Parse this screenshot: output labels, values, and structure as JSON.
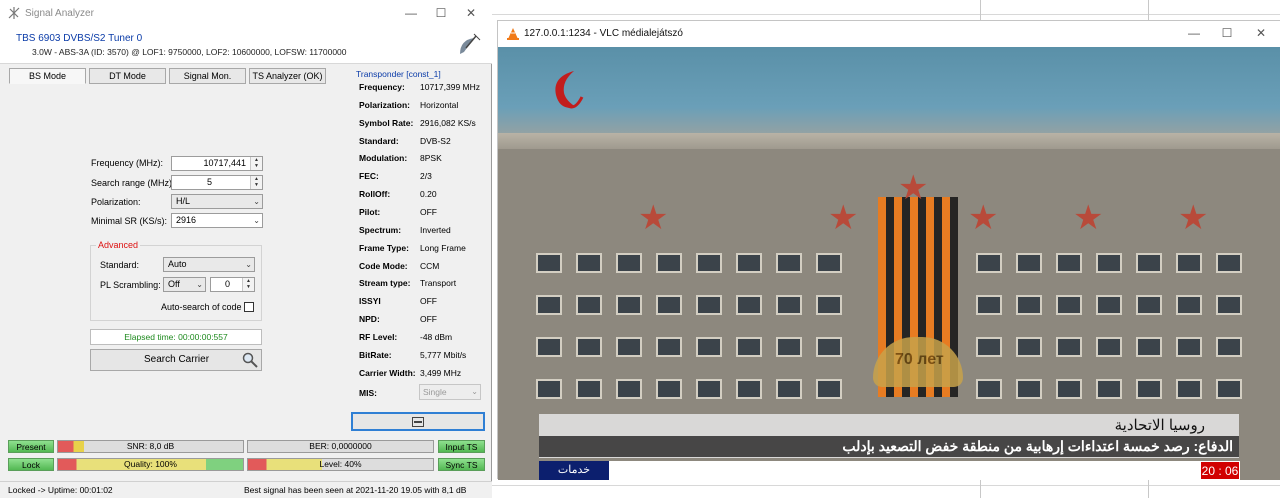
{
  "signal_analyzer": {
    "window_title": "Signal Analyzer",
    "device_name": "TBS 6903 DVBS/S2 Tuner 0",
    "device_info": "3.0W - ABS-3A (ID: 3570) @ LOF1: 9750000, LOF2: 10600000, LOFSW: 11700000",
    "tabs": [
      "BS Mode",
      "DT Mode",
      "Signal Mon.",
      "TS Analyzer (OK)"
    ],
    "active_tab": "BS Mode",
    "form": {
      "frequency_label": "Frequency (MHz):",
      "frequency_value": "10717,441",
      "search_range_label": "Search range (MHz):",
      "search_range_value": "5",
      "polarization_label": "Polarization:",
      "polarization_value": "H/L",
      "minimal_sr_label": "Minimal SR (KS/s):",
      "minimal_sr_value": "2916"
    },
    "advanced": {
      "title": "Advanced",
      "standard_label": "Standard:",
      "standard_value": "Auto",
      "pl_scrambling_label": "PL Scrambling:",
      "pl_scrambling_value": "Off",
      "pl_scrambling_code": "0",
      "auto_search_label": "Auto-search of code"
    },
    "elapsed": "Elapsed time: 00:00:00:557",
    "search_button": "Search Carrier",
    "transponder": {
      "title": "Transponder [const_1]",
      "rows": [
        {
          "label": "Frequency:",
          "value": "10717,399 MHz"
        },
        {
          "label": "Polarization:",
          "value": "Horizontal"
        },
        {
          "label": "Symbol Rate:",
          "value": "2916,082 KS/s"
        },
        {
          "label": "Standard:",
          "value": "DVB-S2"
        },
        {
          "label": "Modulation:",
          "value": "8PSK"
        },
        {
          "label": "FEC:",
          "value": "2/3"
        },
        {
          "label": "RollOff:",
          "value": "0.20"
        },
        {
          "label": "Pilot:",
          "value": "OFF"
        },
        {
          "label": "Spectrum:",
          "value": "Inverted"
        },
        {
          "label": "Frame Type:",
          "value": "Long Frame"
        },
        {
          "label": "Code Mode:",
          "value": "CCM"
        },
        {
          "label": "Stream type:",
          "value": "Transport"
        },
        {
          "label": "ISSYI",
          "value": "OFF"
        },
        {
          "label": "NPD:",
          "value": "OFF"
        },
        {
          "label": "RF Level:",
          "value": "-48 dBm"
        },
        {
          "label": "BitRate:",
          "value": "5,777 Mbit/s"
        },
        {
          "label": "Carrier Width:",
          "value": "3,499 MHz"
        }
      ],
      "mis_label": "MIS:",
      "mis_value": "Single"
    },
    "indicators": {
      "present": "Present",
      "lock": "Lock",
      "input_ts": "Input TS",
      "sync_ts": "Sync TS",
      "snr": "SNR: 8,0 dB",
      "snr_level": 0.14,
      "ber": "BER: 0,0000000",
      "quality": "Quality: 100%",
      "quality_level": 1.0,
      "level": "Level: 40%",
      "level_fraction": 0.4
    },
    "status_left": "Locked -> Uptime: 00:01:02",
    "status_right": "Best signal has been seen at 2021-11-20 19.05 with 8,1 dB"
  },
  "vlc": {
    "window_title": "127.0.0.1:1234 - VLC médialejátszó",
    "caption_line1": "روسيا الاتحادية",
    "caption_line2": "الدفاع: رصد خمسة اعتداءات إرهابية من منطقة خفض التصعيد بإدلب",
    "ticker_badge": "خدمات",
    "clock": "20 : 06",
    "emblem_text": "70 лет"
  },
  "colors": {
    "accent_blue": "#0a3ba8",
    "ok_green": "#53b853",
    "alert_red": "#d11111",
    "vlc_orange": "#f17a18"
  }
}
